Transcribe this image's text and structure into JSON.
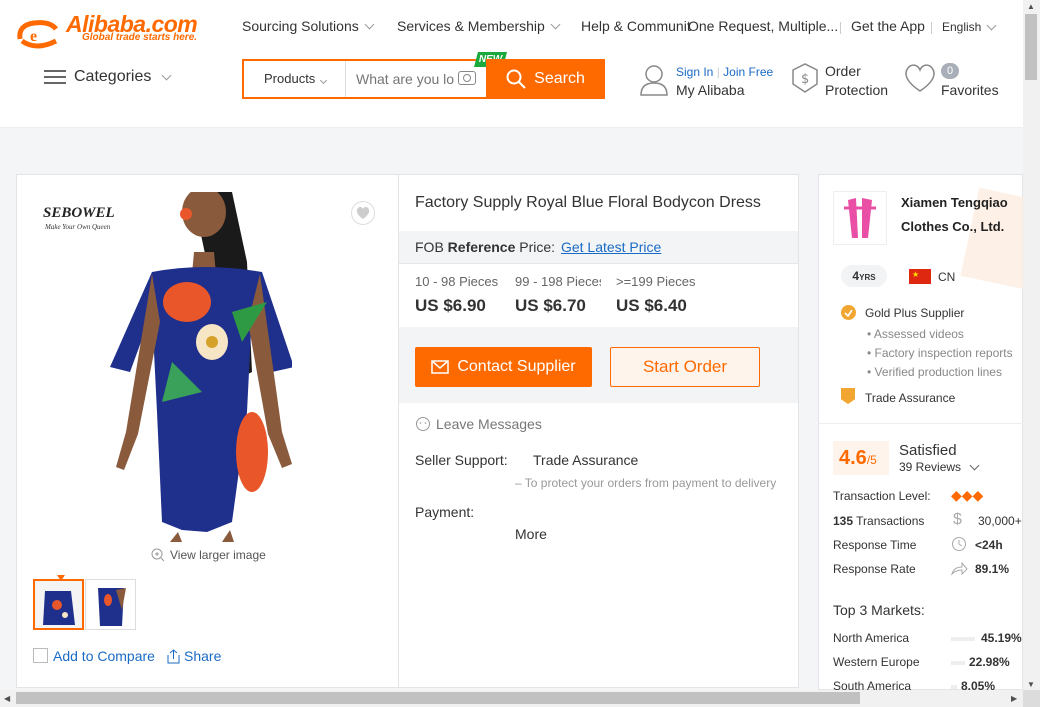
{
  "header": {
    "logo_text": "Alibaba.com",
    "logo_tagline": "Global trade starts here.",
    "nav": [
      "Sourcing Solutions",
      "Services & Membership",
      "Help & Community",
      "One Request, Multiple...",
      "Get the App",
      "English"
    ],
    "categories_label": "Categories",
    "search": {
      "category": "Products",
      "placeholder": "What are you lo",
      "button": "Search",
      "new_badge": "NEW"
    },
    "account": {
      "sign_in": "Sign In",
      "join": "Join Free",
      "label": "My Alibaba"
    },
    "order_protection": {
      "line1": "Order",
      "line2": "Protection"
    },
    "favorites": {
      "count": "0",
      "label": "Favorites"
    }
  },
  "gallery": {
    "brand_logo": "SEBOWEL",
    "brand_tagline": "Make Your Own Queen",
    "view_larger": "View larger image",
    "add_compare": "Add to Compare",
    "share": "Share"
  },
  "product": {
    "title": "Factory Supply Royal Blue Floral Bodycon Dress",
    "fob_prefix": "FOB",
    "fob_bold": "Reference",
    "fob_suffix": "Price:",
    "latest_price_link": "Get Latest Price",
    "tiers": [
      {
        "qty": "10 - 98 Pieces",
        "price": "US $6.90"
      },
      {
        "qty": "99 - 198 Pieces",
        "price": "US $6.70"
      },
      {
        "qty": ">=199 Pieces",
        "price": "US $6.40"
      }
    ],
    "contact_button": "Contact Supplier",
    "order_button": "Start Order",
    "leave_messages": "Leave Messages",
    "seller_support_label": "Seller Support:",
    "trade_assurance": "Trade Assurance",
    "trade_assurance_note": "– To protect your orders from payment to delivery",
    "payment_label": "Payment:",
    "more": "More"
  },
  "supplier": {
    "name_line1": "Xiamen Tengqiao",
    "name_line2": "Clothes Co., Ltd.",
    "years": "4",
    "years_suffix": "YRS",
    "country": "CN",
    "gold_plus": "Gold Plus Supplier",
    "features": [
      "Assessed videos",
      "Factory inspection reports",
      "Verified production lines"
    ],
    "trade_assurance": "Trade Assurance",
    "rating": "4.6",
    "rating_max": "/5",
    "satisfaction": "Satisfied",
    "reviews": "39 Reviews",
    "transaction_level_label": "Transaction Level:",
    "transactions_count": "135",
    "transactions_label": "Transactions",
    "transactions_value": "30,000+",
    "response_time_label": "Response Time",
    "response_time_value": "<24h",
    "response_rate_label": "Response Rate",
    "response_rate_value": "89.1%",
    "top_markets_title": "Top 3 Markets:",
    "markets": [
      {
        "name": "North America",
        "pct": "45.19%"
      },
      {
        "name": "Western Europe",
        "pct": "22.98%"
      },
      {
        "name": "South America",
        "pct": "8.05%"
      }
    ]
  },
  "colors": {
    "accent": "#ff6a00",
    "link": "#1a6bc6",
    "new_badge": "#1aa93c"
  }
}
